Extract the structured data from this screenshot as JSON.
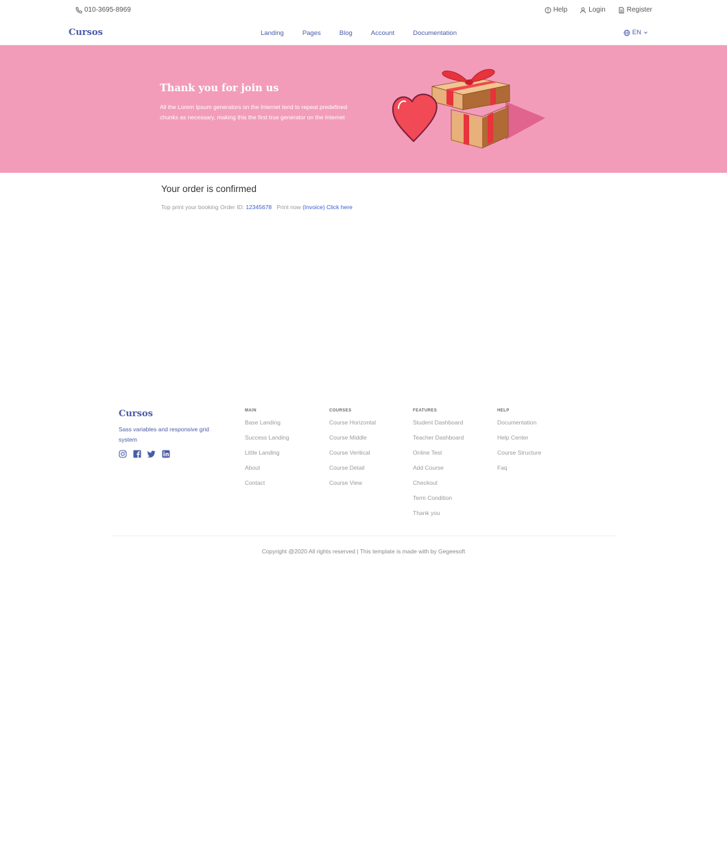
{
  "topbar": {
    "phone": "010-3695-8969",
    "help": "Help",
    "login": "Login",
    "register": "Register"
  },
  "nav": {
    "brand": "Cursos",
    "links": [
      "Landing",
      "Pages",
      "Blog",
      "Account",
      "Documentation"
    ],
    "lang": "EN"
  },
  "hero": {
    "title": "Thank you for join us",
    "text": "All the Lorem Ipsum generators on the Internet tend to repeat predefined chunks as necessary, making this the first true generator on the Internet",
    "bg_color": "#f29cba"
  },
  "order": {
    "title": "Your order is confirmed",
    "prefix": "Top print your booking Order ID:",
    "order_id": "12345678",
    "print_label": "Print now",
    "invoice_link": "(Invoice) Click here"
  },
  "footer": {
    "brand": "Cursos",
    "tagline": "Sass variables and responsive grid system",
    "socials": [
      "instagram-icon",
      "facebook-icon",
      "twitter-icon",
      "linkedin-icon"
    ],
    "columns": [
      {
        "head": "MAIN",
        "links": [
          "Base Landing",
          "Success Landing",
          "Little Landing",
          "About",
          "Contact"
        ]
      },
      {
        "head": "COURSES",
        "links": [
          "Course Horizontal",
          "Course Middle",
          "Course Veritical",
          "Course Detail",
          "Course View"
        ]
      },
      {
        "head": "FEATURES",
        "links": [
          "Student Dashboard",
          "Teacher Dashboard",
          "Online Test",
          "Add Course",
          "Checkout",
          "Term Condition",
          "Thank you"
        ]
      },
      {
        "head": "HELP",
        "links": [
          "Documentation",
          "Help Center",
          "Course Structure",
          "Faq"
        ]
      }
    ],
    "copyright": "Copyright @2020 All rights reserved | This template is made with by Gegeesoft"
  },
  "colors": {
    "brand": "#4a5aa8",
    "link": "#3b5bd5",
    "hero": "#f29cba"
  }
}
